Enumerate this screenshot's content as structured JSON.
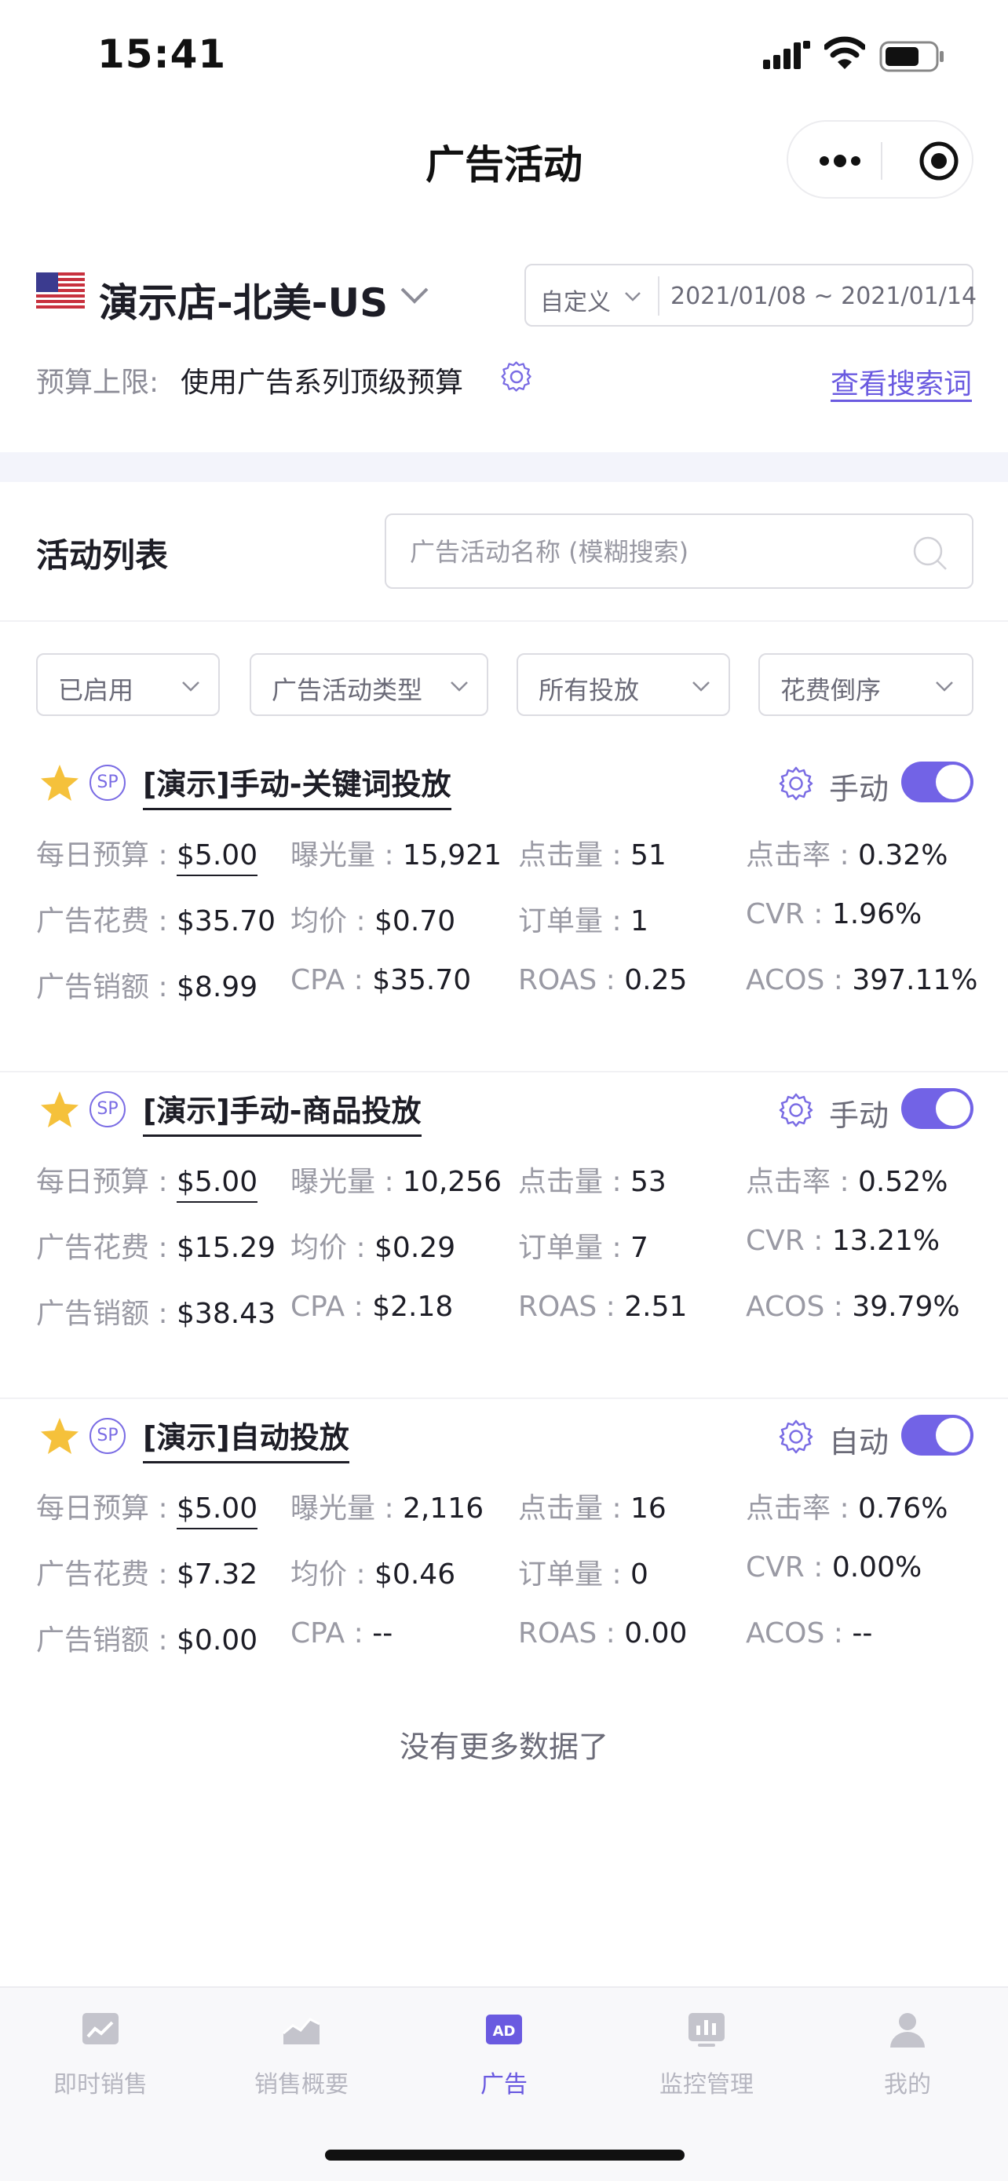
{
  "status_bar": {
    "time": "15:41"
  },
  "nav": {
    "title": "广告活动"
  },
  "store": {
    "name": "演示店-北美-US",
    "date_mode": "自定义",
    "date_range": "2021/01/08 ~ 2021/01/14"
  },
  "budget": {
    "label": "预算上限:",
    "value": "使用广告系列顶级预算",
    "search_terms_link": "查看搜索词"
  },
  "list": {
    "title": "活动列表",
    "search_placeholder": "广告活动名称 (模糊搜索)"
  },
  "filters": [
    "已启用",
    "广告活动类型",
    "所有投放",
    "花费倒序"
  ],
  "colors": {
    "accent": "#6a5ae0",
    "star": "#f5c13b",
    "toggle_on": "#7263e6"
  },
  "campaigns": [
    {
      "badge": "SP",
      "name": "[演示]手动-关键词投放",
      "mode": "手动",
      "enabled": true,
      "metrics": [
        [
          {
            "label": "每日预算 :",
            "value": "$5.00"
          },
          {
            "label": "曝光量 :",
            "value": "15,921"
          },
          {
            "label": "点击量 :",
            "value": "51"
          },
          {
            "label": "点击率 :",
            "value": "0.32%"
          }
        ],
        [
          {
            "label": "广告花费 :",
            "value": "$35.70"
          },
          {
            "label": "均价 :",
            "value": "$0.70"
          },
          {
            "label": "订单量 :",
            "value": "1"
          },
          {
            "label": "CVR :",
            "value": "1.96%"
          }
        ],
        [
          {
            "label": "广告销额 :",
            "value": "$8.99"
          },
          {
            "label": "CPA :",
            "value": "$35.70"
          },
          {
            "label": "ROAS :",
            "value": "0.25"
          },
          {
            "label": "ACOS :",
            "value": "397.11%"
          }
        ]
      ]
    },
    {
      "badge": "SP",
      "name": "[演示]手动-商品投放",
      "mode": "手动",
      "enabled": true,
      "metrics": [
        [
          {
            "label": "每日预算 :",
            "value": "$5.00"
          },
          {
            "label": "曝光量 :",
            "value": "10,256"
          },
          {
            "label": "点击量 :",
            "value": "53"
          },
          {
            "label": "点击率 :",
            "value": "0.52%"
          }
        ],
        [
          {
            "label": "广告花费 :",
            "value": "$15.29"
          },
          {
            "label": "均价 :",
            "value": "$0.29"
          },
          {
            "label": "订单量 :",
            "value": "7"
          },
          {
            "label": "CVR :",
            "value": "13.21%"
          }
        ],
        [
          {
            "label": "广告销额 :",
            "value": "$38.43"
          },
          {
            "label": "CPA :",
            "value": "$2.18"
          },
          {
            "label": "ROAS :",
            "value": "2.51"
          },
          {
            "label": "ACOS :",
            "value": "39.79%"
          }
        ]
      ]
    },
    {
      "badge": "SP",
      "name": "[演示]自动投放",
      "mode": "自动",
      "enabled": true,
      "metrics": [
        [
          {
            "label": "每日预算 :",
            "value": "$5.00"
          },
          {
            "label": "曝光量 :",
            "value": "2,116"
          },
          {
            "label": "点击量 :",
            "value": "16"
          },
          {
            "label": "点击率 :",
            "value": "0.76%"
          }
        ],
        [
          {
            "label": "广告花费 :",
            "value": "$7.32"
          },
          {
            "label": "均价 :",
            "value": "$0.46"
          },
          {
            "label": "订单量 :",
            "value": "0"
          },
          {
            "label": "CVR :",
            "value": "0.00%"
          }
        ],
        [
          {
            "label": "广告销额 :",
            "value": "$0.00"
          },
          {
            "label": "CPA :",
            "value": "--"
          },
          {
            "label": "ROAS :",
            "value": "0.00"
          },
          {
            "label": "ACOS :",
            "value": "--"
          }
        ]
      ]
    }
  ],
  "footer_text": "没有更多数据了",
  "tabbar": {
    "active": 2,
    "tabs": [
      {
        "label": "即时销售",
        "icon": "sales-chart-icon"
      },
      {
        "label": "销售概要",
        "icon": "area-chart-icon"
      },
      {
        "label": "广告",
        "icon": "ad-icon"
      },
      {
        "label": "监控管理",
        "icon": "monitor-icon"
      },
      {
        "label": "我的",
        "icon": "profile-icon"
      }
    ]
  }
}
